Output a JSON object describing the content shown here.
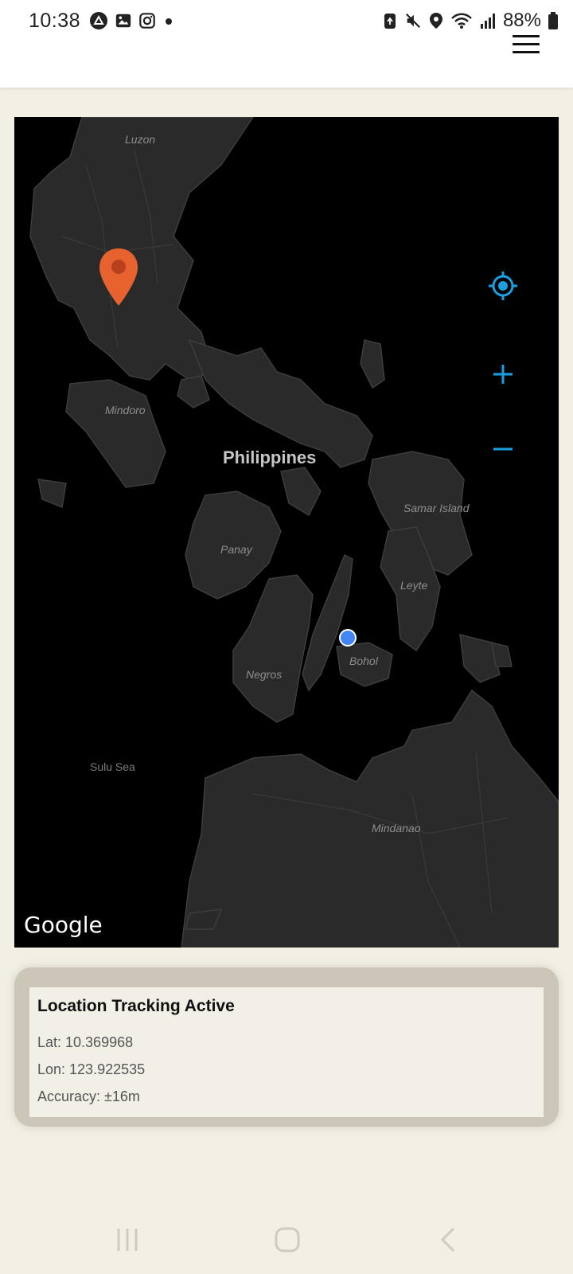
{
  "status_bar": {
    "time": "10:38",
    "battery": "88%",
    "left_icons": [
      "app-a-icon",
      "gallery-icon",
      "instagram-icon",
      "dot-icon"
    ],
    "right_icons": [
      "recycle-icon",
      "mute-icon",
      "location-icon",
      "wifi-icon",
      "signal-icon",
      "battery-icon"
    ]
  },
  "app_bar": {
    "menu_icon": "hamburger-menu-icon"
  },
  "map": {
    "labels": {
      "luzon": "Luzon",
      "mindoro": "Mindoro",
      "philippines": "Philippines",
      "samar": "Samar Island",
      "panay": "Panay",
      "leyte": "Leyte",
      "negros": "Negros",
      "bohol": "Bohol",
      "sulu_sea": "Sulu Sea",
      "mindanao": "Mindanao"
    },
    "attribution": "Google",
    "controls": {
      "locate_icon": "my-location-icon",
      "zoom_in_icon": "zoom-in-icon",
      "zoom_out_icon": "zoom-out-icon"
    },
    "accent_color": "#1aa0e0",
    "pin_color": "#e8622f",
    "user_dot_color": "#4285f4"
  },
  "tracking": {
    "title": "Location Tracking Active",
    "lat": "Lat: 10.369968",
    "lon": "Lon: 123.922535",
    "accuracy": "Accuracy: ±16m"
  },
  "nav_bar": {
    "icons": [
      "recents-icon",
      "home-icon",
      "back-icon"
    ]
  }
}
